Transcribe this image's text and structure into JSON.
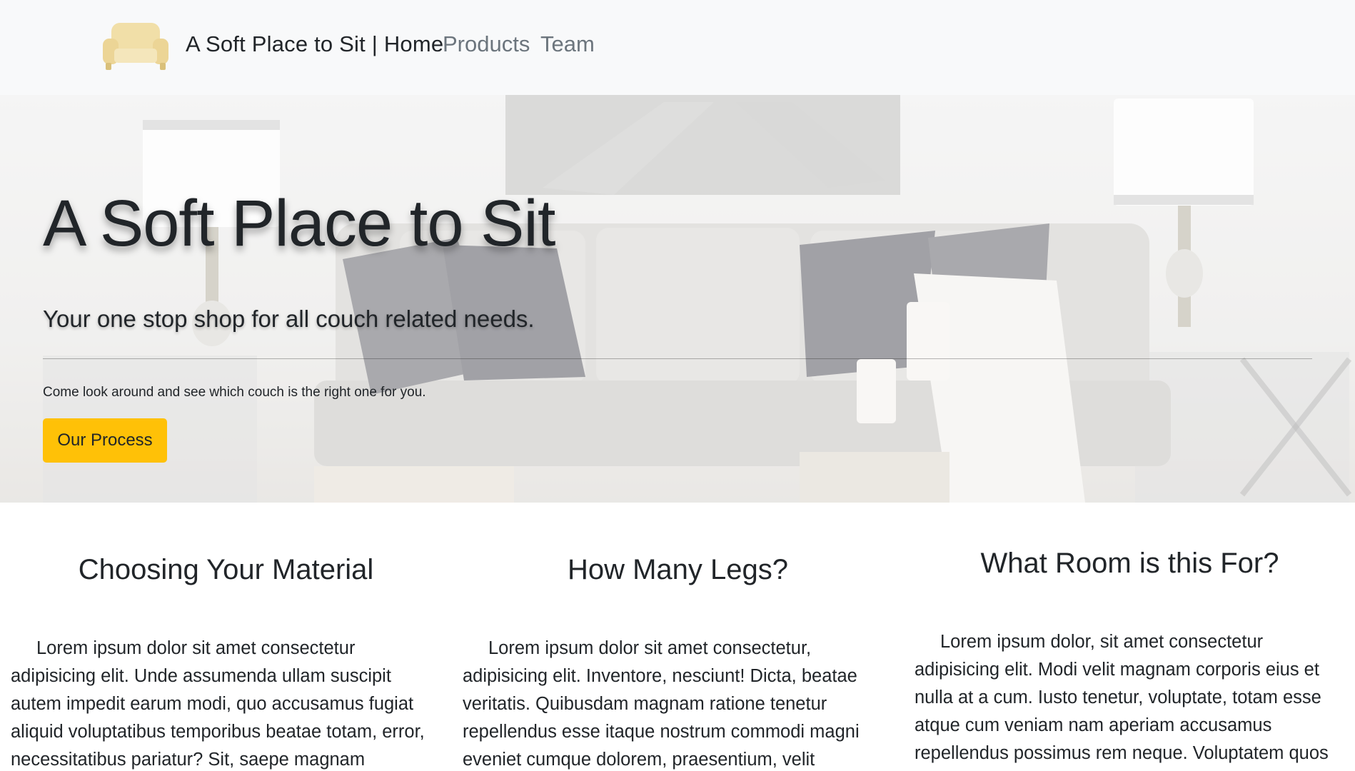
{
  "navbar": {
    "logo_icon": "sofa-icon",
    "brand": "A Soft Place to Sit | Home",
    "links": [
      "Products",
      "Team"
    ]
  },
  "hero": {
    "title": "A Soft Place to Sit",
    "lead": "Your one stop shop for all couch related needs.",
    "text": "Come look around and see which couch is the right one for you.",
    "button_label": "Our Process",
    "button_color": "#ffc107"
  },
  "features": [
    {
      "heading": "Choosing Your Material",
      "body": "Lorem ipsum dolor sit amet consectetur adipisicing elit. Unde assumenda ullam suscipit autem impedit earum modi, quo accusamus fugiat aliquid voluptatibus temporibus beatae totam, error, necessitatibus pariatur? Sit, saepe magnam"
    },
    {
      "heading": "How Many Legs?",
      "body": "Lorem ipsum dolor sit amet consectetur, adipisicing elit. Inventore, nesciunt! Dicta, beatae veritatis. Quibusdam magnam ratione tenetur repellendus esse itaque nostrum commodi magni eveniet cumque dolorem, praesentium, velit"
    },
    {
      "heading": "What Room is this For?",
      "body": "Lorem ipsum dolor, sit amet consectetur adipisicing elit. Modi velit magnam corporis eius et nulla at a cum. Iusto tenetur, voluptate, totam esse atque cum veniam nam aperiam accusamus repellendus possimus rem neque. Voluptatem quos"
    }
  ]
}
